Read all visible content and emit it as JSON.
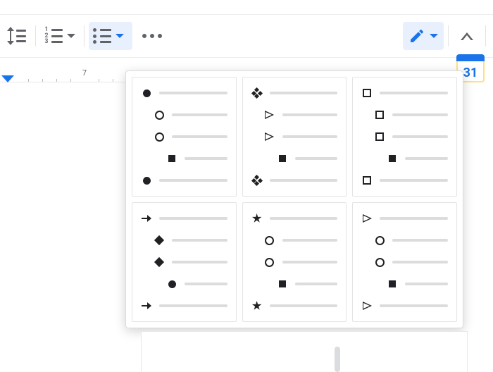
{
  "toolbar": {
    "line_spacing_name": "line-spacing",
    "numbered_list_name": "numbered-list",
    "bulleted_list_name": "bulleted-list",
    "more_name": "more",
    "mode_name": "editing-mode",
    "collapse_name": "collapse"
  },
  "ruler": {
    "number": "7"
  },
  "sidebar": {
    "calendar_day": "31"
  },
  "bullet_options": [
    {
      "id": "disc-ring-square",
      "levels": [
        "disc",
        "ring",
        "ring",
        "square",
        "disc"
      ],
      "indents": [
        0,
        1,
        1,
        2,
        0
      ]
    },
    {
      "id": "diamond4-arrowopen-square",
      "levels": [
        "diamond4",
        "arrow-open",
        "arrow-open",
        "square",
        "diamond4"
      ],
      "indents": [
        0,
        1,
        1,
        2,
        0
      ]
    },
    {
      "id": "squareo-squareo-square",
      "levels": [
        "square-o",
        "square-o",
        "square-o",
        "square",
        "square-o"
      ],
      "indents": [
        0,
        1,
        1,
        2,
        0
      ]
    },
    {
      "id": "arrowr-diamond-disc",
      "levels": [
        "arrow-r",
        "diamond",
        "diamond",
        "disc",
        "arrow-r"
      ],
      "indents": [
        0,
        1,
        1,
        2,
        0
      ]
    },
    {
      "id": "star-ring-square",
      "levels": [
        "star",
        "ring",
        "ring",
        "square",
        "star"
      ],
      "indents": [
        0,
        1,
        1,
        2,
        0
      ]
    },
    {
      "id": "arrowopen-ring-square",
      "levels": [
        "arrow-open",
        "ring",
        "ring",
        "square",
        "arrow-open"
      ],
      "indents": [
        0,
        1,
        1,
        2,
        0
      ]
    }
  ]
}
